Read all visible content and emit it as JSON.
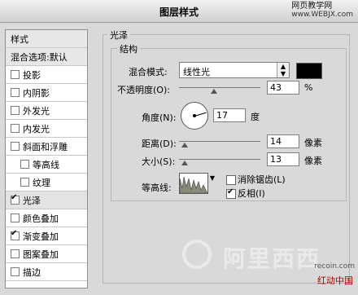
{
  "window": {
    "title": "图层样式"
  },
  "watermark_top": {
    "line1": "网页教学网",
    "line2": "www.WEBJX.com"
  },
  "sidebar": {
    "header": "样式",
    "blending": "混合选项:默认",
    "items": [
      {
        "label": "投影",
        "checked": false,
        "sub": false
      },
      {
        "label": "内阴影",
        "checked": false,
        "sub": false
      },
      {
        "label": "外发光",
        "checked": false,
        "sub": false
      },
      {
        "label": "内发光",
        "checked": false,
        "sub": false
      },
      {
        "label": "斜面和浮雕",
        "checked": false,
        "sub": false
      },
      {
        "label": "等高线",
        "checked": false,
        "sub": true
      },
      {
        "label": "纹理",
        "checked": false,
        "sub": true
      },
      {
        "label": "光泽",
        "checked": true,
        "sub": false,
        "active": true
      },
      {
        "label": "颜色叠加",
        "checked": false,
        "sub": false
      },
      {
        "label": "渐变叠加",
        "checked": true,
        "sub": false
      },
      {
        "label": "图案叠加",
        "checked": false,
        "sub": false
      },
      {
        "label": "描边",
        "checked": false,
        "sub": false
      }
    ]
  },
  "panel": {
    "section_title": "光泽",
    "group_title": "结构",
    "blend_mode": {
      "label": "混合模式:",
      "value": "线性光"
    },
    "color": "#000000",
    "opacity": {
      "label": "不透明度(O):",
      "value": "43",
      "unit": "%",
      "fraction": 0.43
    },
    "angle": {
      "label": "角度(N):",
      "value": "17",
      "unit": "度"
    },
    "distance": {
      "label": "距离(D):",
      "value": "14",
      "unit": "像素",
      "fraction": 0.07
    },
    "size": {
      "label": "大小(S):",
      "value": "13",
      "unit": "像素",
      "fraction": 0.07
    },
    "contour": {
      "label": "等高线:"
    },
    "antialias": {
      "label": "消除锯齿(L)",
      "checked": false
    },
    "invert": {
      "label": "反相(I)",
      "checked": true
    }
  },
  "watermark_bottom": {
    "big": "阿里西西",
    "small1": "recoin.com",
    "small2": "红动中国"
  }
}
